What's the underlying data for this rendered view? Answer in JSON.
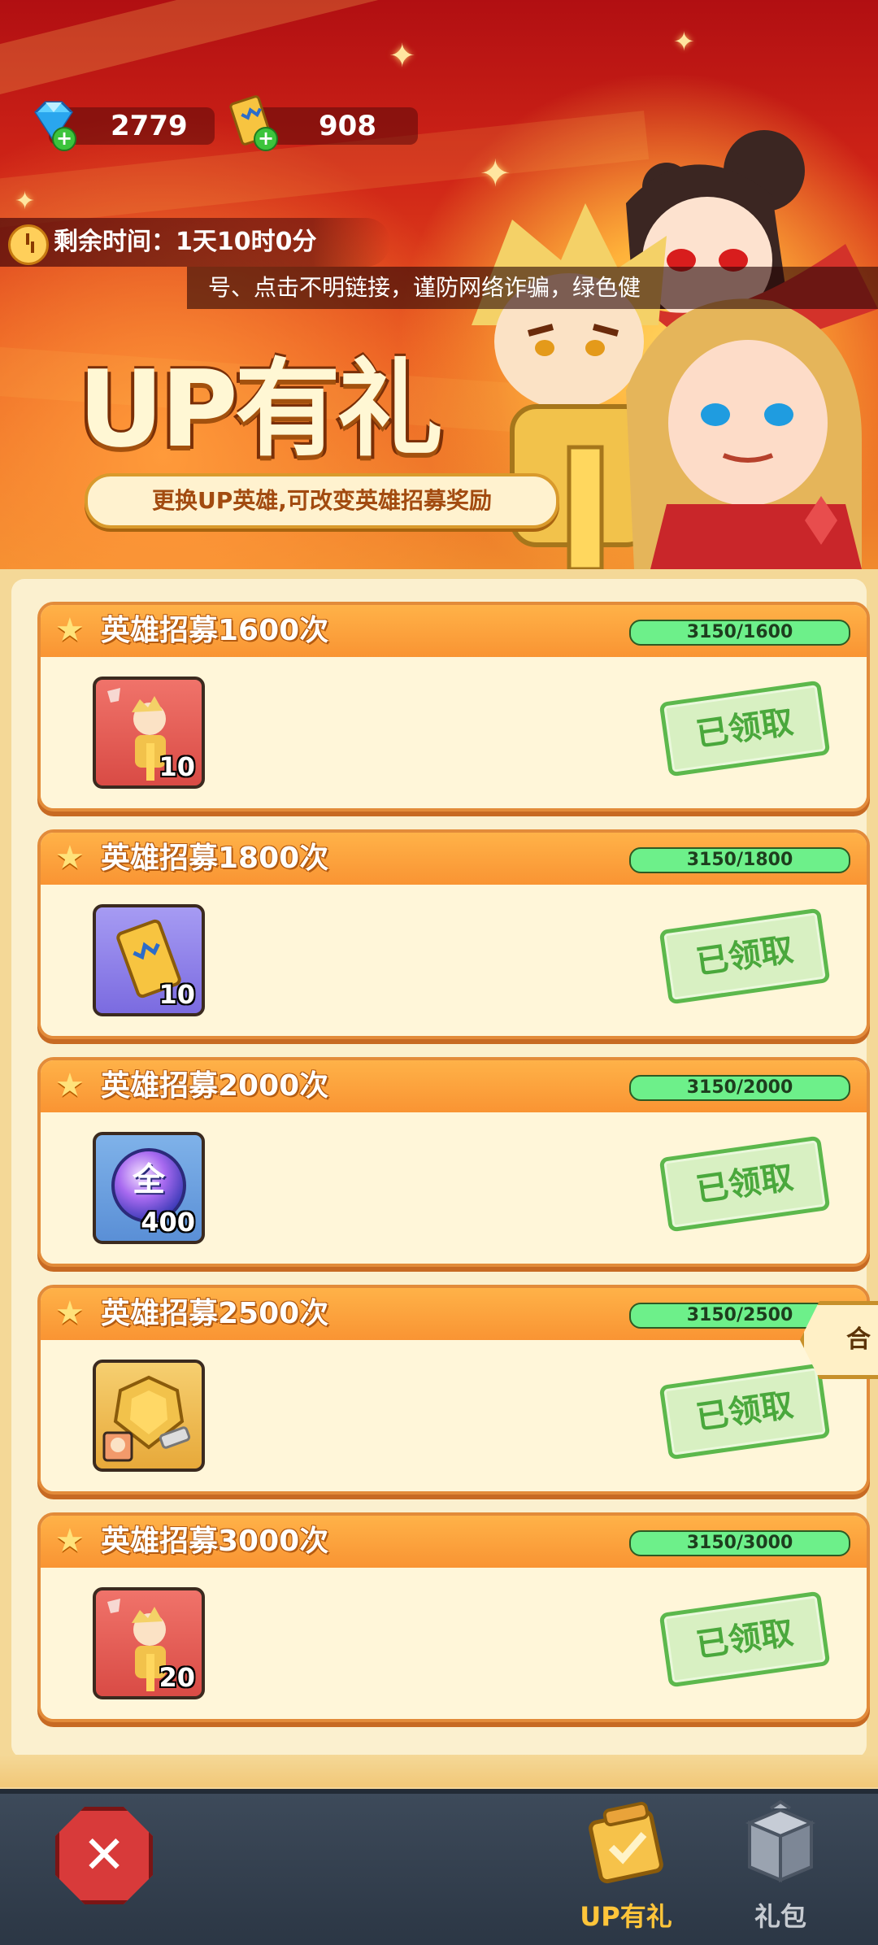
{
  "currencies": {
    "gems": "2779",
    "tickets": "908"
  },
  "timer": {
    "label": "剩余时间：1天10时0分"
  },
  "notice": {
    "text": "号、点击不明链接，谨防网络诈骗，绿色健"
  },
  "banner": {
    "title": "UP有礼",
    "subtitle": "更换UP英雄,可改变英雄招募奖励"
  },
  "rewards": [
    {
      "title": "英雄招募1600次",
      "progress_text": "3150/1600",
      "progress_fraction": 1.0,
      "item": "hero-shard",
      "qty": "10",
      "status": "已领取"
    },
    {
      "title": "英雄招募1800次",
      "progress_text": "3150/1800",
      "progress_fraction": 1.0,
      "item": "recruit-ticket",
      "qty": "10",
      "status": "已领取"
    },
    {
      "title": "英雄招募2000次",
      "progress_text": "3150/2000",
      "progress_fraction": 1.0,
      "item": "orb-全",
      "orb_char": "全",
      "qty": "400",
      "status": "已领取"
    },
    {
      "title": "英雄招募2500次",
      "progress_text": "3150/2500",
      "progress_fraction": 1.0,
      "item": "gold-armor",
      "qty": "",
      "status": "已领取"
    },
    {
      "title": "英雄招募3000次",
      "progress_text": "3150/3000",
      "progress_fraction": 1.0,
      "item": "hero-shard",
      "qty": "20",
      "status": "已领取"
    }
  ],
  "side_tag": {
    "label": "合作"
  },
  "bottom_nav": {
    "close_symbol": "✕",
    "tabs": [
      {
        "label": "UP有礼",
        "active": true,
        "color": "#ffc53a"
      },
      {
        "label": "礼包",
        "active": false,
        "color": "#c7cbd1"
      }
    ]
  }
}
